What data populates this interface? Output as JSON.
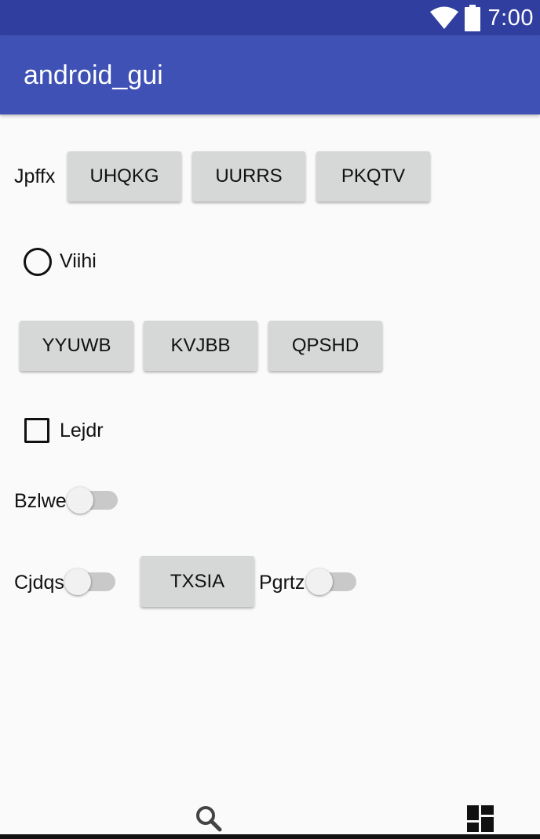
{
  "status_bar": {
    "time": "7:00",
    "icons": [
      "wifi-icon",
      "battery-icon"
    ],
    "background": "#303f9f"
  },
  "app_bar": {
    "title": "android_gui",
    "background": "#3f51b5"
  },
  "content": {
    "row1": {
      "label": "Jpffx",
      "buttons": [
        "UHQKG",
        "UURRS",
        "PKQTV"
      ]
    },
    "radio": {
      "label": "Viihi",
      "checked": false
    },
    "row2": {
      "buttons": [
        "YYUWB",
        "KVJBB",
        "QPSHD"
      ]
    },
    "checkbox": {
      "label": "Lejdr",
      "checked": false
    },
    "switch1": {
      "label": "Bzlwe",
      "on": false
    },
    "row3": {
      "switch_left": {
        "label": "Cjdqs",
        "on": false
      },
      "button": "TXSIA",
      "switch_right": {
        "label": "Pgrtz",
        "on": false
      }
    }
  },
  "bottom_nav": {
    "icons": [
      "search-icon",
      "dashboard-icon"
    ]
  }
}
